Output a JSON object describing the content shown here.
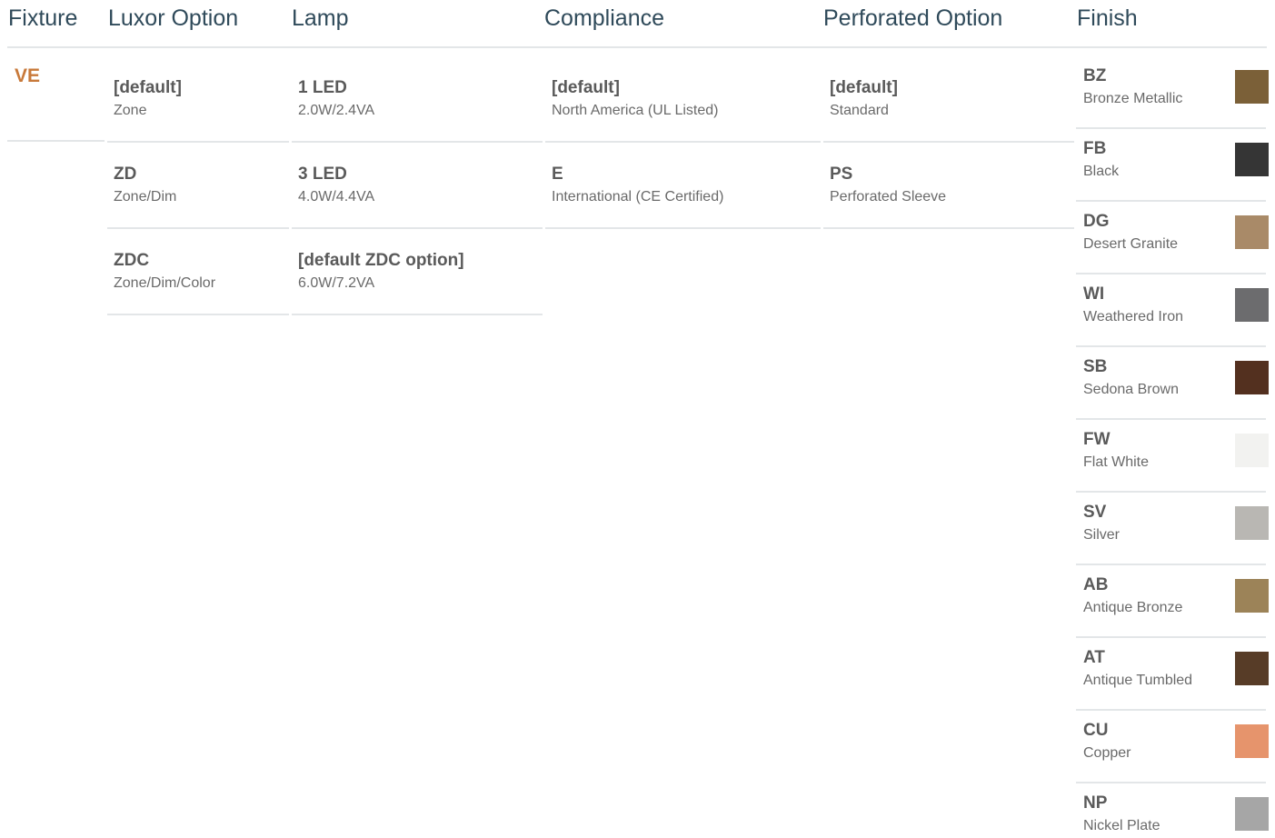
{
  "headers": {
    "fixture": "Fixture",
    "luxor_option": "Luxor Option",
    "lamp": "Lamp",
    "compliance": "Compliance",
    "perforated_option": "Perforated Option",
    "finish": "Finish"
  },
  "fixture": {
    "code": "VE",
    "color": "#c8793a"
  },
  "luxor_options": [
    {
      "code": "[default]",
      "desc": "Zone"
    },
    {
      "code": "ZD",
      "desc": "Zone/Dim"
    },
    {
      "code": "ZDC",
      "desc": "Zone/Dim/Color"
    }
  ],
  "lamps": [
    {
      "code": "1 LED",
      "desc": "2.0W/2.4VA"
    },
    {
      "code": "3 LED",
      "desc": "4.0W/4.4VA"
    },
    {
      "code": "[default ZDC option]",
      "desc": "6.0W/7.2VA"
    }
  ],
  "compliance": [
    {
      "code": "[default]",
      "desc": "North America (UL Listed)"
    },
    {
      "code": "E",
      "desc": "International (CE Certified)"
    }
  ],
  "perforated_options": [
    {
      "code": "[default]",
      "desc": "Standard"
    },
    {
      "code": "PS",
      "desc": "Perforated Sleeve"
    }
  ],
  "finishes": [
    {
      "code": "BZ",
      "desc": "Bronze Metallic",
      "swatch": "#7b6038"
    },
    {
      "code": "FB",
      "desc": "Black",
      "swatch": "#353535"
    },
    {
      "code": "DG",
      "desc": "Desert Granite",
      "swatch": "#a98a68"
    },
    {
      "code": "WI",
      "desc": "Weathered Iron",
      "swatch": "#6c6c6e"
    },
    {
      "code": "SB",
      "desc": "Sedona Brown",
      "swatch": "#53301f"
    },
    {
      "code": "FW",
      "desc": "Flat White",
      "swatch": "#f2f2f0"
    },
    {
      "code": "SV",
      "desc": "Silver",
      "swatch": "#b9b7b3"
    },
    {
      "code": "AB",
      "desc": "Antique Bronze",
      "swatch": "#9c8358"
    },
    {
      "code": "AT",
      "desc": "Antique Tumbled",
      "swatch": "#573c27"
    },
    {
      "code": "CU",
      "desc": "Copper",
      "swatch": "#e6946c"
    },
    {
      "code": "NP",
      "desc": "Nickel Plate",
      "swatch": "#a6a6a6"
    }
  ],
  "colors": {
    "header_text": "#2f4a5a",
    "code_text": "#5a5a5a",
    "desc_text": "#6a6a6a",
    "rule": "#e3e6e8"
  }
}
